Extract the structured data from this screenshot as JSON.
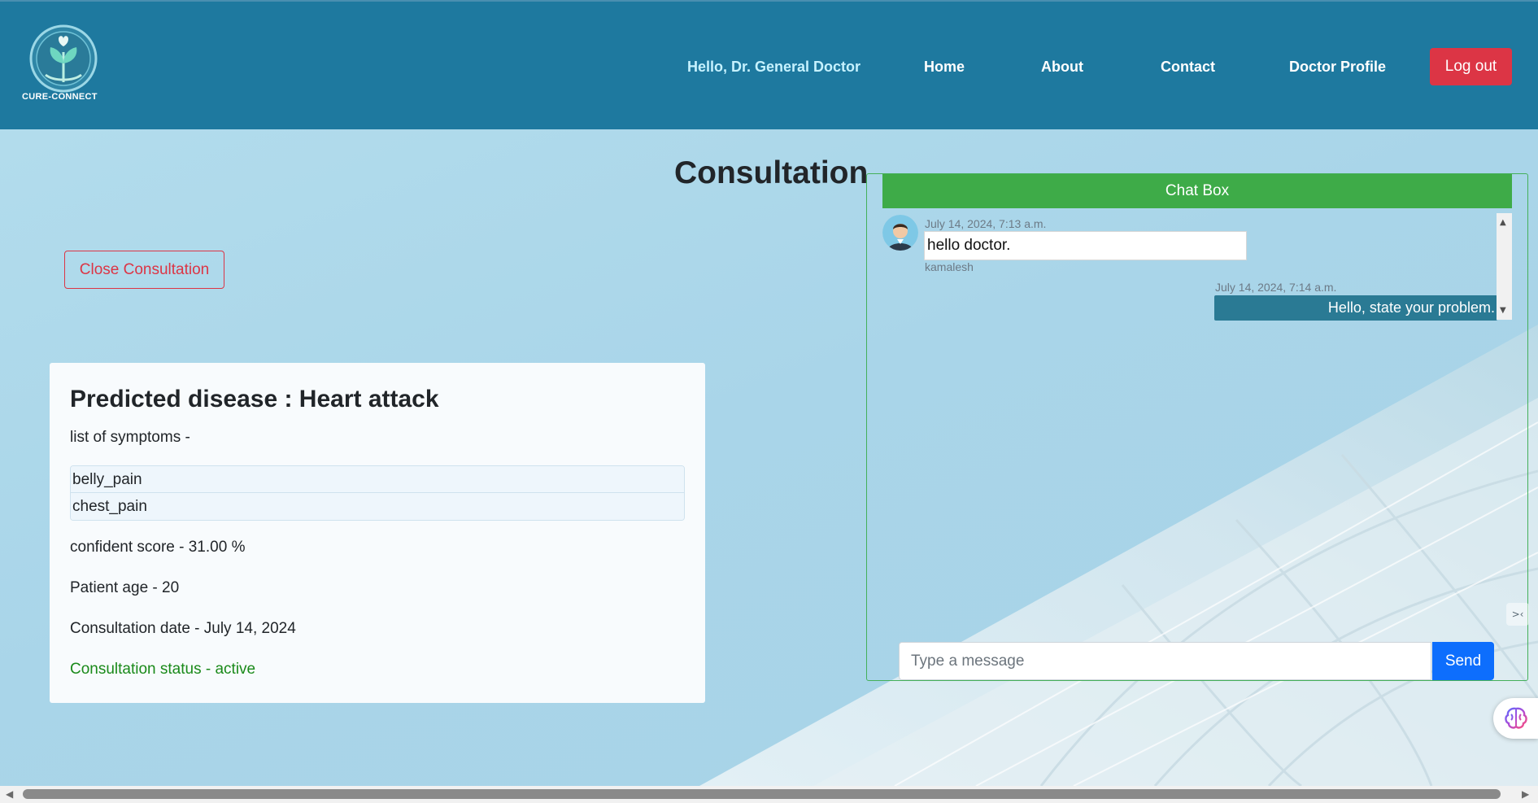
{
  "brand": {
    "name": "CURE-CONNECT"
  },
  "nav": {
    "greeting": "Hello, Dr. General Doctor",
    "items": [
      "Home",
      "About",
      "Contact",
      "Doctor Profile"
    ],
    "logout_label": "Log out"
  },
  "page": {
    "title": "Consultation",
    "close_button_label": "Close Consultation"
  },
  "prediction": {
    "title": "Predicted disease : Heart attack",
    "symptoms_label": "list of symptoms -",
    "symptoms": [
      "belly_pain",
      "chest_pain"
    ],
    "confidence": "confident score - 31.00 %",
    "patient_age": "Patient age - 20",
    "consultation_date": "Consultation date - July 14, 2024",
    "status": "Consultation status - active"
  },
  "chat": {
    "header": "Chat Box",
    "messages": [
      {
        "time": "July 14, 2024, 7:13 a.m.",
        "text": "hello doctor.",
        "author": "kamalesh",
        "direction": "incoming"
      },
      {
        "time": "July 14, 2024, 7:14 a.m.",
        "text": "Hello, state your problem.",
        "direction": "outgoing"
      }
    ],
    "input_placeholder": "Type a message",
    "send_label": "Send"
  },
  "colors": {
    "navbar": "#1e799f",
    "danger": "#dc3545",
    "chat_header": "#3eab48",
    "send": "#0d6efd",
    "outgoing_bubble": "#2a7a94",
    "status_active": "#1a8a1a"
  },
  "icons": [
    "cure-connect-logo-icon",
    "avatar-icon",
    "scroll-up-icon",
    "scroll-down-icon",
    "collapse-icon",
    "brain-icon"
  ]
}
